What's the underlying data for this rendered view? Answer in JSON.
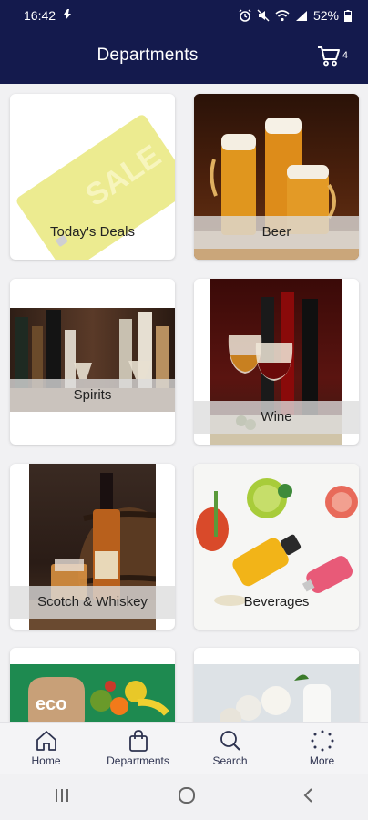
{
  "status_bar": {
    "time": "16:42",
    "battery": "52%"
  },
  "header": {
    "title": "Departments",
    "cart_count": "4"
  },
  "departments": [
    {
      "label": "Today's Deals",
      "image": "sale-card",
      "sale_text": "SALE"
    },
    {
      "label": "Beer",
      "image": "beer-glasses"
    },
    {
      "label": "Spirits",
      "image": "spirits-bottles"
    },
    {
      "label": "Wine",
      "image": "wine-bottles"
    },
    {
      "label": "Scotch & Whiskey",
      "image": "whiskey-barrel"
    },
    {
      "label": "Beverages",
      "image": "beverages"
    },
    {
      "label": "",
      "image": "eco-groceries",
      "badge": "eco"
    },
    {
      "label": "",
      "image": "dairy"
    }
  ],
  "bottom_nav": [
    {
      "label": "Home",
      "icon": "home-icon"
    },
    {
      "label": "Departments",
      "icon": "shopping-bag-icon"
    },
    {
      "label": "Search",
      "icon": "search-icon"
    },
    {
      "label": "More",
      "icon": "more-dots-icon"
    }
  ],
  "colors": {
    "header": "#141a4d",
    "background": "#f1f1f3",
    "label_overlay": "#dcdcdc"
  }
}
